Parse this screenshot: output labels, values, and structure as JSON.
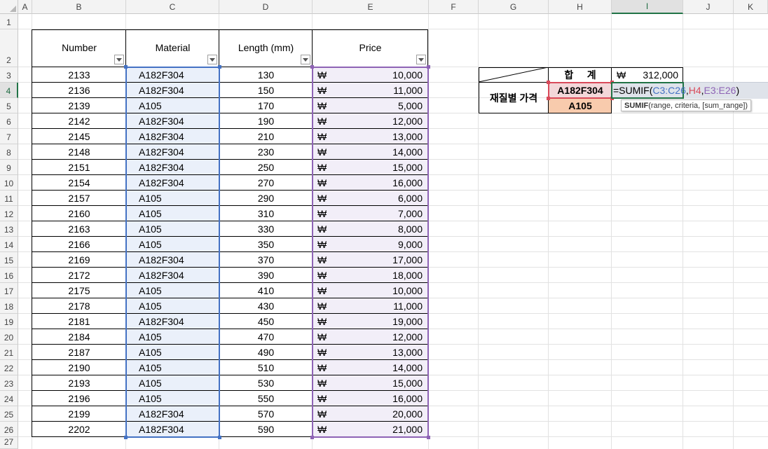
{
  "columns": [
    "A",
    "B",
    "C",
    "D",
    "E",
    "F",
    "G",
    "H",
    "I",
    "J",
    "K"
  ],
  "rows": [
    "1",
    "2",
    "3",
    "4",
    "5",
    "6",
    "7",
    "8",
    "9",
    "10",
    "11",
    "12",
    "13",
    "14",
    "15",
    "16",
    "17",
    "18",
    "19",
    "20",
    "21",
    "22",
    "23",
    "24",
    "25",
    "26",
    "27"
  ],
  "selected_column": "I",
  "selected_row": "4",
  "table": {
    "headers": [
      "Number",
      "Material",
      "Length (mm)",
      "Price"
    ],
    "currency_symbol": "₩",
    "rows": [
      [
        "2133",
        "A182F304",
        "130",
        "10,000"
      ],
      [
        "2136",
        "A182F304",
        "150",
        "11,000"
      ],
      [
        "2139",
        "A105",
        "170",
        "5,000"
      ],
      [
        "2142",
        "A182F304",
        "190",
        "12,000"
      ],
      [
        "2145",
        "A182F304",
        "210",
        "13,000"
      ],
      [
        "2148",
        "A182F304",
        "230",
        "14,000"
      ],
      [
        "2151",
        "A182F304",
        "250",
        "15,000"
      ],
      [
        "2154",
        "A182F304",
        "270",
        "16,000"
      ],
      [
        "2157",
        "A105",
        "290",
        "6,000"
      ],
      [
        "2160",
        "A105",
        "310",
        "7,000"
      ],
      [
        "2163",
        "A105",
        "330",
        "8,000"
      ],
      [
        "2166",
        "A105",
        "350",
        "9,000"
      ],
      [
        "2169",
        "A182F304",
        "370",
        "17,000"
      ],
      [
        "2172",
        "A182F304",
        "390",
        "18,000"
      ],
      [
        "2175",
        "A105",
        "410",
        "10,000"
      ],
      [
        "2178",
        "A105",
        "430",
        "11,000"
      ],
      [
        "2181",
        "A182F304",
        "450",
        "19,000"
      ],
      [
        "2184",
        "A105",
        "470",
        "12,000"
      ],
      [
        "2187",
        "A105",
        "490",
        "13,000"
      ],
      [
        "2190",
        "A105",
        "510",
        "14,000"
      ],
      [
        "2193",
        "A105",
        "530",
        "15,000"
      ],
      [
        "2196",
        "A105",
        "550",
        "16,000"
      ],
      [
        "2199",
        "A182F304",
        "570",
        "20,000"
      ],
      [
        "2202",
        "A182F304",
        "590",
        "21,000"
      ]
    ]
  },
  "summary": {
    "total_label": "합     계",
    "total_currency": "₩",
    "total_value": "312,000",
    "group_label": "재질별 가격",
    "mat1": "A182F304",
    "mat2": "A105"
  },
  "formula": {
    "eq": "=SUMIF(",
    "arg1": "C3:C26",
    "comma1": ",",
    "arg2": "H4",
    "comma2": ",",
    "arg3": "E3:E26",
    "close": ")"
  },
  "tooltip": {
    "fn": "SUMIF",
    "args": "(range, criteria, [sum_range])"
  },
  "colors": {
    "material_range": "#4472c4",
    "price_range": "#8e63b5",
    "criteria_cell": "#d94a5a",
    "a105_fill": "#f8cbad",
    "selection": "#217346"
  }
}
